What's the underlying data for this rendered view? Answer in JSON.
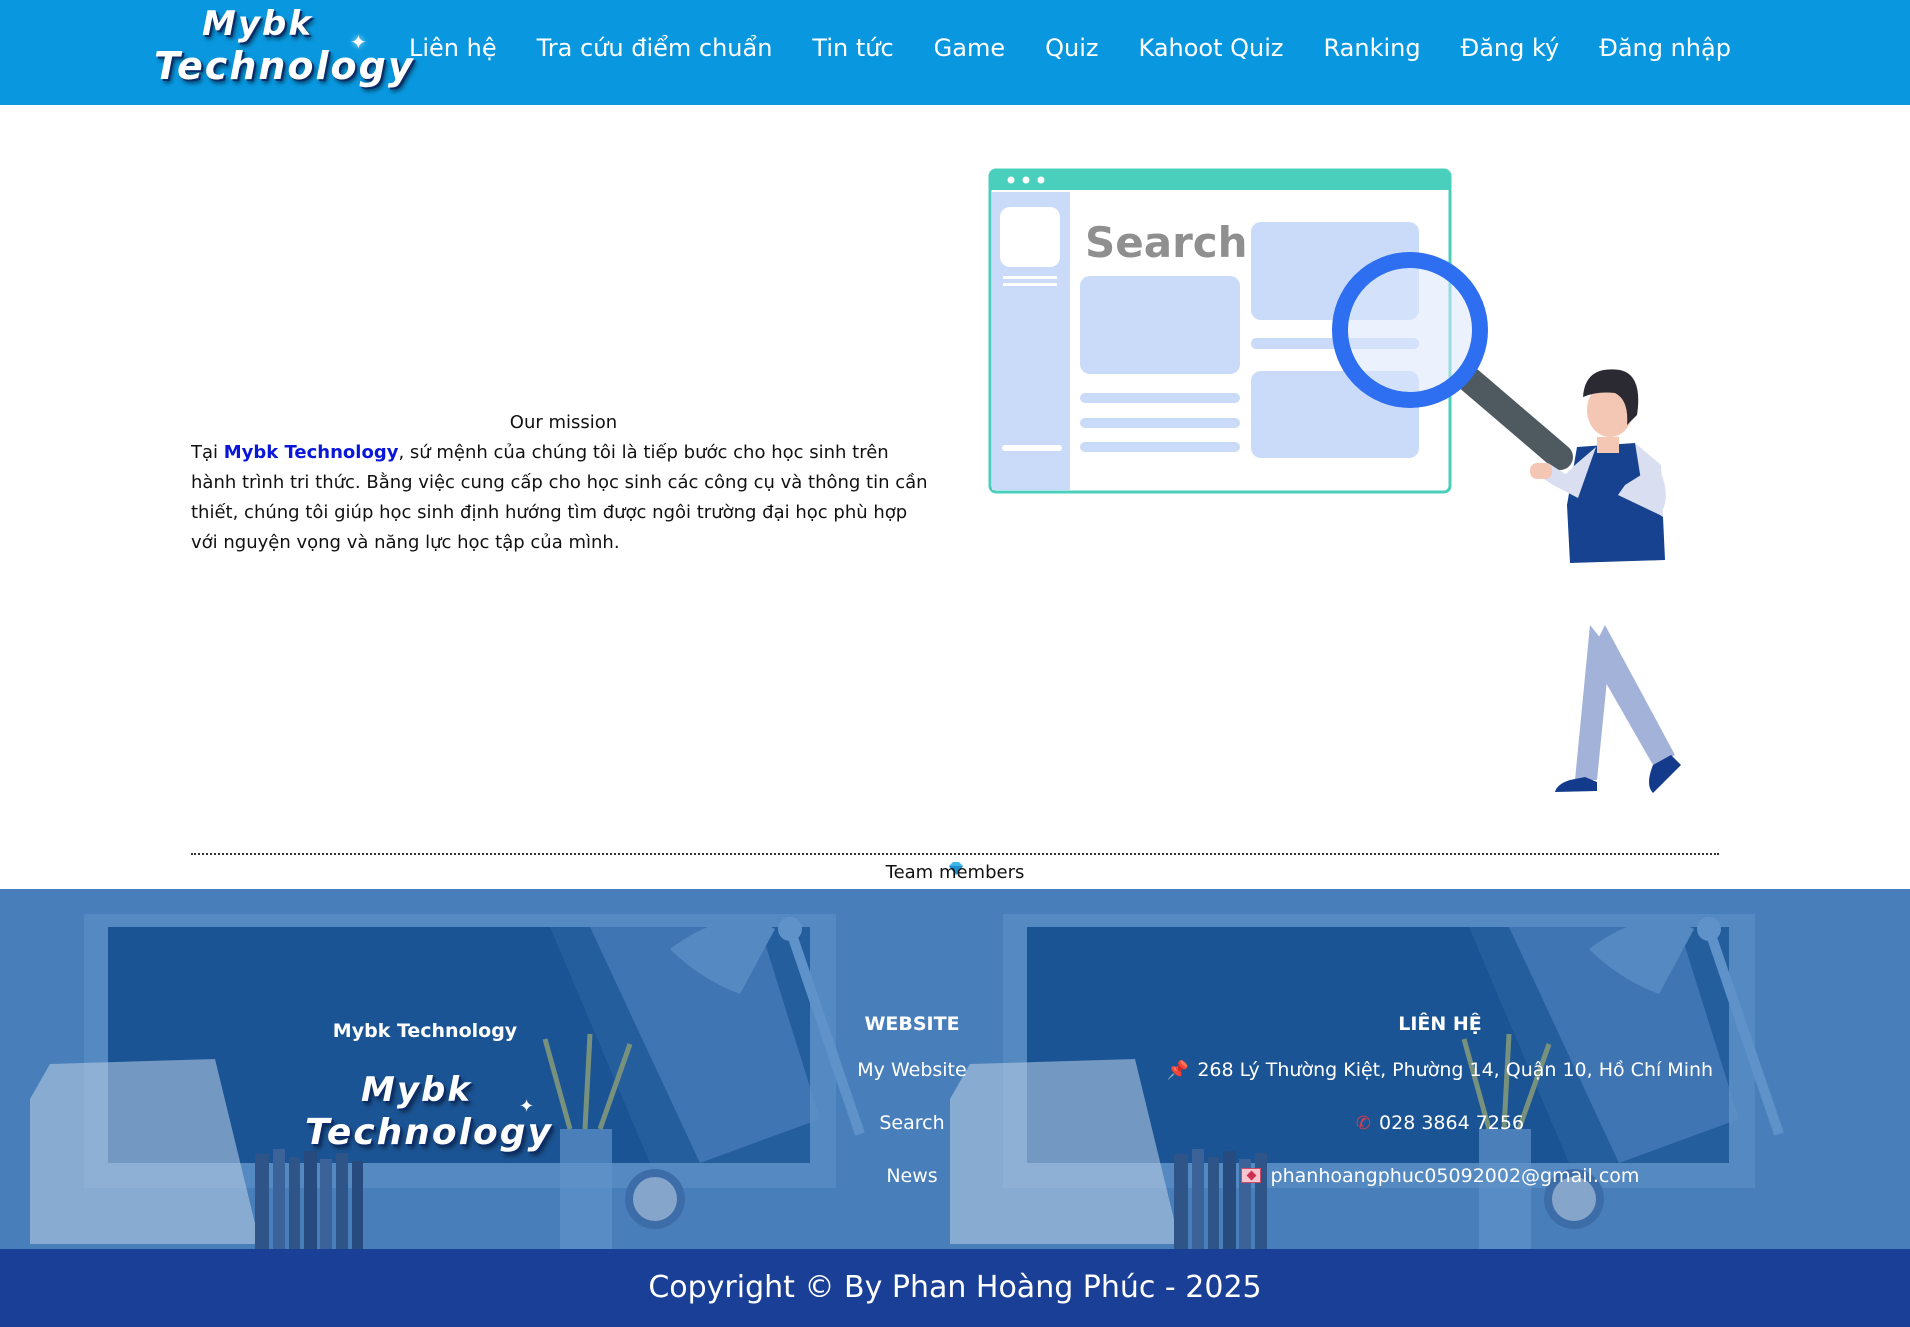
{
  "nav": {
    "logo_line1": "Mybk",
    "logo_line2": "Technology",
    "items": [
      "Liên hệ",
      "Tra cứu điểm chuẩn",
      "Tin tức",
      "Game",
      "Quiz",
      "Kahoot Quiz",
      "Ranking",
      "Đăng ký",
      "Đăng nhập"
    ],
    "background": "#0998e0"
  },
  "mission": {
    "title": "Our mission",
    "text_before": "Tại ",
    "brand": "Mybk Technology",
    "text_after": ", sứ mệnh của chúng tôi là tiếp bước cho học sinh trên hành trình tri thức. Bằng việc cung cấp cho học sinh các công cụ và thông tin cần thiết, chúng tôi giúp học sinh định hướng tìm được ngôi trường đại học phù hợp với nguyện vọng và năng lực học tập của mình."
  },
  "illustration": {
    "search_word": "Search",
    "icon": "person-magnifier-illustration"
  },
  "team": {
    "title": "Team members"
  },
  "footer": {
    "brand_name": "Mybk Technology",
    "logo_line1": "Mybk",
    "logo_line2": "Technology",
    "website_heading": "WEBSITE",
    "website_links": [
      "My Website",
      "Search",
      "News"
    ],
    "contact_heading": "LIÊN HỆ",
    "address": "268 Lý Thường Kiệt, Phường 14, Quận 10, Hồ Chí Minh",
    "phone": "028 3864 7256",
    "email": "phanhoangphuc05092002@gmail.com",
    "background": "#4d82bb"
  },
  "copyright": {
    "text": "Copyright © By Phan Hoàng Phúc - 2025",
    "background": "#1a3f97"
  }
}
